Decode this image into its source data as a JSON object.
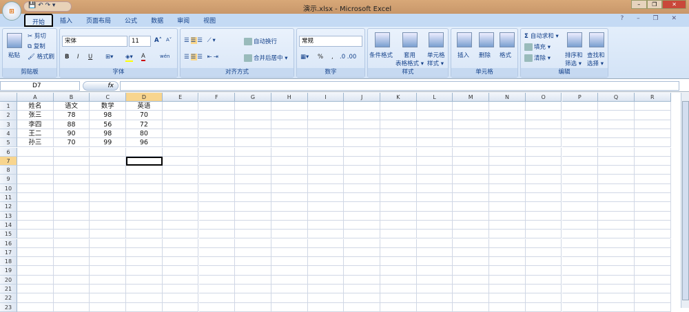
{
  "window": {
    "title": "演示.xlsx - Microsoft Excel",
    "office_button": "⊞",
    "qat": "💾 ↶ ↷ ▾",
    "buttons": [
      "–",
      "❐",
      "✕"
    ]
  },
  "tabs": [
    "开始",
    "插入",
    "页面布局",
    "公式",
    "数据",
    "审阅",
    "视图"
  ],
  "ribbon_controls": "?  –  ❐  ✕",
  "ribbon": {
    "clipboard": {
      "label": "剪贴板",
      "paste": "粘贴",
      "cut": "剪切",
      "copy": "复制",
      "format_painter": "格式刷"
    },
    "font": {
      "label": "字体",
      "font_name": "宋体",
      "font_size": "11",
      "bold": "B",
      "italic": "I",
      "underline": "U",
      "grow": "A˄",
      "shrink": "A˅",
      "font_color": "A",
      "phonetic": "wén"
    },
    "alignment": {
      "label": "对齐方式",
      "wrap": "自动换行",
      "merge": "合并后居中 ▾"
    },
    "number": {
      "label": "数字",
      "format": "常规",
      "percent": "%",
      "comma": ","
    },
    "styles": {
      "label": "样式",
      "conditional": "条件格式",
      "table_format_1": "套用",
      "table_format_2": "表格格式 ▾",
      "cell_style_1": "单元格",
      "cell_style_2": "样式 ▾"
    },
    "cells": {
      "label": "单元格",
      "insert": "插入",
      "delete": "删除",
      "format": "格式"
    },
    "editing": {
      "label": "编辑",
      "autosum": "自动求和 ▾",
      "fill": "填充 ▾",
      "clear": "清除 ▾",
      "sort_1": "排序和",
      "sort_2": "筛选 ▾",
      "find_1": "查找和",
      "find_2": "选择 ▾"
    }
  },
  "formula_bar": {
    "name_box": "D7",
    "fx": "fx",
    "formula": ""
  },
  "sheet": {
    "columns": [
      "A",
      "B",
      "C",
      "D",
      "E",
      "F",
      "G",
      "H",
      "I",
      "J",
      "K",
      "L",
      "M",
      "N",
      "O",
      "P",
      "Q",
      "R"
    ],
    "row_count": 23,
    "selected_cell": "D7",
    "rows": [
      [
        "姓名",
        "语文",
        "数学",
        "英语"
      ],
      [
        "张三",
        "78",
        "98",
        "70"
      ],
      [
        "李四",
        "88",
        "56",
        "72"
      ],
      [
        "王二",
        "90",
        "98",
        "80"
      ],
      [
        "孙三",
        "70",
        "99",
        "96"
      ]
    ]
  }
}
